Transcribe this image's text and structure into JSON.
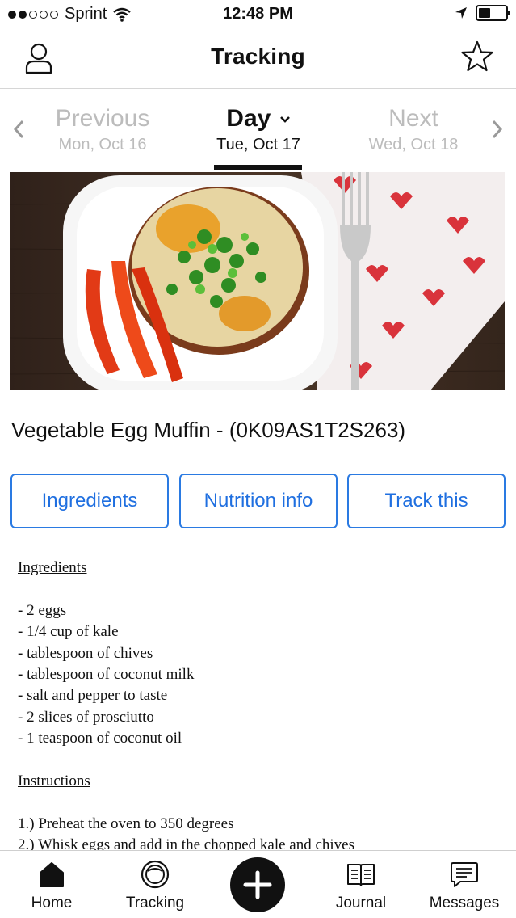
{
  "status_bar": {
    "carrier": "Sprint",
    "time": "12:48 PM"
  },
  "header": {
    "title": "Tracking"
  },
  "day_selector": {
    "previous": {
      "label": "Previous",
      "date": "Mon, Oct 16"
    },
    "current": {
      "label": "Day",
      "date": "Tue, Oct 17"
    },
    "next": {
      "label": "Next",
      "date": "Wed, Oct 18"
    }
  },
  "recipe": {
    "title": "Vegetable Egg Muffin - (0K09AS1T2S263)",
    "buttons": {
      "ingredients": "Ingredients",
      "nutrition": "Nutrition info",
      "track": "Track this"
    },
    "ingredients_heading": "Ingredients",
    "ingredients": [
      "- 2 eggs",
      "- 1/4 cup of kale",
      "- tablespoon of chives",
      "- tablespoon of coconut milk",
      "- salt and pepper to taste",
      "- 2 slices of prosciutto",
      "- 1 teaspoon of coconut oil"
    ],
    "instructions_heading": "Instructions",
    "instructions": [
      "1.) Preheat the oven to 350 degrees",
      "2.) Whisk eggs and add in the chopped kale and chives"
    ]
  },
  "tab_bar": {
    "home": "Home",
    "tracking": "Tracking",
    "journal": "Journal",
    "messages": "Messages"
  },
  "colors": {
    "accent_blue": "#1f6fe0",
    "text": "#111111",
    "inactive_gray": "#bcbcbc"
  }
}
